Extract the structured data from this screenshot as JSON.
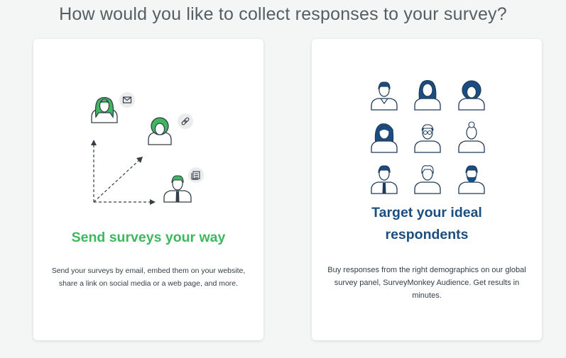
{
  "page": {
    "heading": "How would you like to collect responses to your survey?"
  },
  "cards": [
    {
      "title": "Send surveys your way",
      "description": "Send your surveys by email, embed them on your website, share a link on social media or a web page, and more.",
      "accent_color": "#3eb75f",
      "icons": [
        "email-icon",
        "link-icon",
        "web-page-icon"
      ]
    },
    {
      "title_line1": "Target your ideal",
      "title_line2": "respondents",
      "description": "Buy responses from the right demographics on our global survey panel, SurveyMonkey Audience. Get results in minutes.",
      "accent_color": "#1a4e81"
    }
  ]
}
